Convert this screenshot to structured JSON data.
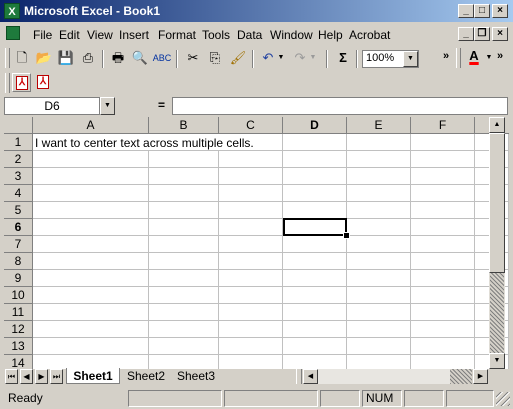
{
  "window": {
    "title": "Microsoft Excel - Book1",
    "app_icon": "excel-icon",
    "controls": [
      "minimize-icon",
      "maximize-icon",
      "close-icon"
    ]
  },
  "menu": {
    "items": [
      {
        "label": "File"
      },
      {
        "label": "Edit"
      },
      {
        "label": "View"
      },
      {
        "label": "Insert"
      },
      {
        "label": "Format"
      },
      {
        "label": "Tools"
      },
      {
        "label": "Data"
      },
      {
        "label": "Window"
      },
      {
        "label": "Help"
      },
      {
        "label": "Acrobat"
      }
    ]
  },
  "toolbar": {
    "zoom": "100%",
    "autosum_symbol": "Σ",
    "font_color_letter": "A",
    "font_color": "#ff0000"
  },
  "formula_bar": {
    "name_box": "D6",
    "equals": "=",
    "formula": ""
  },
  "sheet": {
    "columns": [
      "A",
      "B",
      "C",
      "D",
      "E",
      "F"
    ],
    "rows": [
      "1",
      "2",
      "3",
      "4",
      "5",
      "6",
      "7",
      "8",
      "9",
      "10",
      "11",
      "12",
      "13",
      "14"
    ],
    "cell_A1": "I want to center text across multiple cells.",
    "active_column": "D",
    "active_row": "6"
  },
  "tabs": {
    "sheets": [
      "Sheet1",
      "Sheet2",
      "Sheet3"
    ],
    "active": "Sheet1"
  },
  "status": {
    "ready": "Ready",
    "num": "NUM"
  }
}
